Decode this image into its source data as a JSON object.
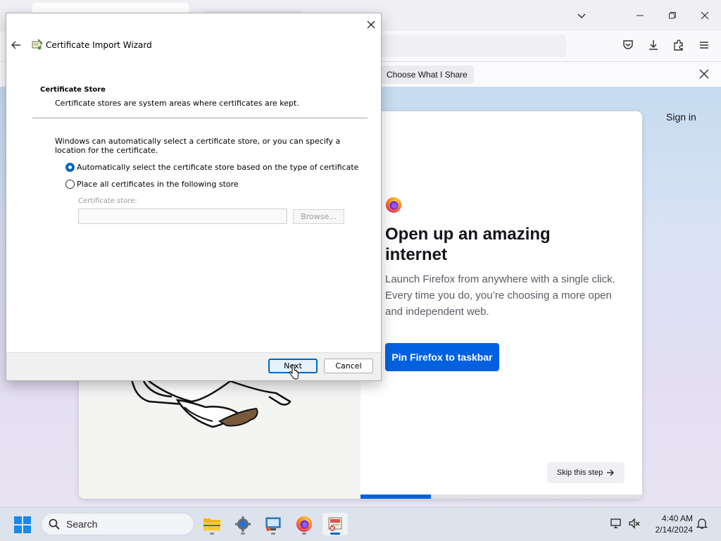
{
  "browser": {
    "notification": {
      "share_button": "Choose What I Share"
    },
    "signin": "Sign in",
    "onboarding": {
      "heading": "Open up an amazing internet",
      "body": "Launch Firefox from anywhere with a single click. Every time you do, you’re choosing a more open and independent web.",
      "pin_button": "Pin Firefox to taskbar",
      "skip_button": "Skip this step",
      "progress": 0.25
    }
  },
  "dialog": {
    "title": "Certificate Import Wizard",
    "section_title": "Certificate Store",
    "section_subtitle": "Certificate stores are system areas where certificates are kept.",
    "description": "Windows can automatically select a certificate store, or you can specify a location for the certificate.",
    "options": [
      {
        "label": "Automatically select the certificate store based on the type of certificate",
        "checked": true
      },
      {
        "label": "Place all certificates in the following store",
        "checked": false
      }
    ],
    "store_label": "Certificate store:",
    "store_value": "",
    "browse_button": "Browse...",
    "next_button": "Next",
    "cancel_button": "Cancel"
  },
  "taskbar": {
    "search_placeholder": "Search",
    "apps": [
      "file-explorer",
      "settings",
      "remote-desktop",
      "firefox",
      "certificate-manager"
    ],
    "active_app": "certificate-manager",
    "time": "4:40 AM",
    "date": "2/14/2024"
  },
  "colors": {
    "accent": "#0067c0",
    "firefox_blue": "#0061e0"
  }
}
